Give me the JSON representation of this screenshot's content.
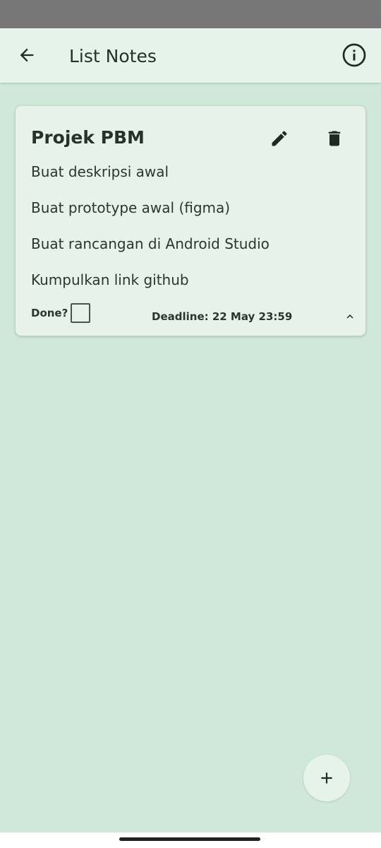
{
  "app_bar": {
    "title": "List Notes",
    "back_icon": "arrow-back-icon",
    "info_icon": "info-outline-icon"
  },
  "note": {
    "title": "Projek PBM",
    "tasks": [
      "Buat deskripsi awal",
      "Buat prototype awal (figma)",
      "Buat rancangan di Android Studio",
      "Kumpulkan link github"
    ],
    "done_label": "Done?",
    "done_checked": false,
    "deadline": "Deadline: 22 May 23:59",
    "edit_icon": "pencil-icon",
    "delete_icon": "trash-icon",
    "collapse_icon": "chevron-up-icon"
  },
  "fab": {
    "icon": "plus-icon"
  },
  "colors": {
    "background": "#cfe8d9",
    "surface": "#e6f3ea",
    "status_bar": "#777777",
    "text": "#24322b"
  }
}
